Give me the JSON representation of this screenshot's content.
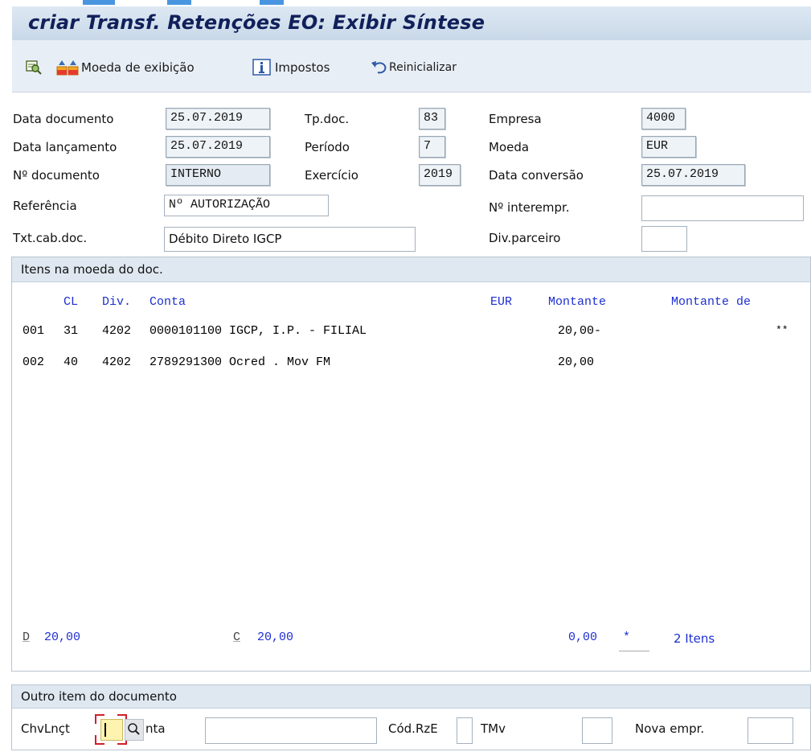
{
  "window": {
    "title": "criar Transf. Retenções EO: Exibir Síntese"
  },
  "toolbar": {
    "currency_label": "Moeda de exibição",
    "taxes_label": "Impostos",
    "reset_label": "Reinicializar"
  },
  "header": {
    "doc_date": {
      "label": "Data documento",
      "value": "25.07.2019"
    },
    "post_date": {
      "label": "Data lançamento",
      "value": "25.07.2019"
    },
    "doc_number": {
      "label": "Nº documento",
      "value": "INTERNO"
    },
    "reference": {
      "label": "Referência",
      "value": "Nº AUTORIZAÇÃO"
    },
    "header_text": {
      "label": "Txt.cab.doc.",
      "value": "Débito Direto IGCP"
    },
    "doc_type": {
      "label": "Tp.doc.",
      "value": "83"
    },
    "period": {
      "label": "Período",
      "value": "7"
    },
    "fiscal_year": {
      "label": "Exercício",
      "value": "2019"
    },
    "company": {
      "label": "Empresa",
      "value": "4000"
    },
    "currency": {
      "label": "Moeda",
      "value": "EUR"
    },
    "conv_date": {
      "label": "Data conversão",
      "value": "25.07.2019"
    },
    "intercompany": {
      "label": "Nº interempr.",
      "value": ""
    },
    "partner_div": {
      "label": "Div.parceiro",
      "value": ""
    }
  },
  "items": {
    "group_title": "Itens na moeda do doc.",
    "col_cl": "CL",
    "col_div": "Div.",
    "col_conta": "Conta",
    "col_eur": "EUR",
    "col_montante": "Montante",
    "col_montante_de": "Montante de",
    "rows": [
      {
        "num": "001",
        "cl": "31",
        "div": "4202",
        "account": "0000101100 IGCP, I.P. - FILIAL",
        "amount": "20,00-",
        "flag": "**"
      },
      {
        "num": "002",
        "cl": "40",
        "div": "4202",
        "account": "2789291300 Ocred . Mov FM",
        "amount": "20,00",
        "flag": ""
      }
    ],
    "totals": {
      "debit_prefix": "D",
      "debit_value": "20,00",
      "credit_prefix": "C",
      "credit_value": "20,00",
      "balance": "0,00",
      "balance_flag": "*",
      "item_count": "2 Itens"
    }
  },
  "other_item": {
    "group_title": "Outro item do documento",
    "posting_key_label": "ChvLnçt",
    "account_label": "nta",
    "account_value": "",
    "sgl_label": "Cód.RzE",
    "tmv_label": "TMv",
    "new_company_label": "Nova empr."
  },
  "colors": {
    "accent_blue": "#1e2fcf",
    "title_color": "#10205a"
  }
}
